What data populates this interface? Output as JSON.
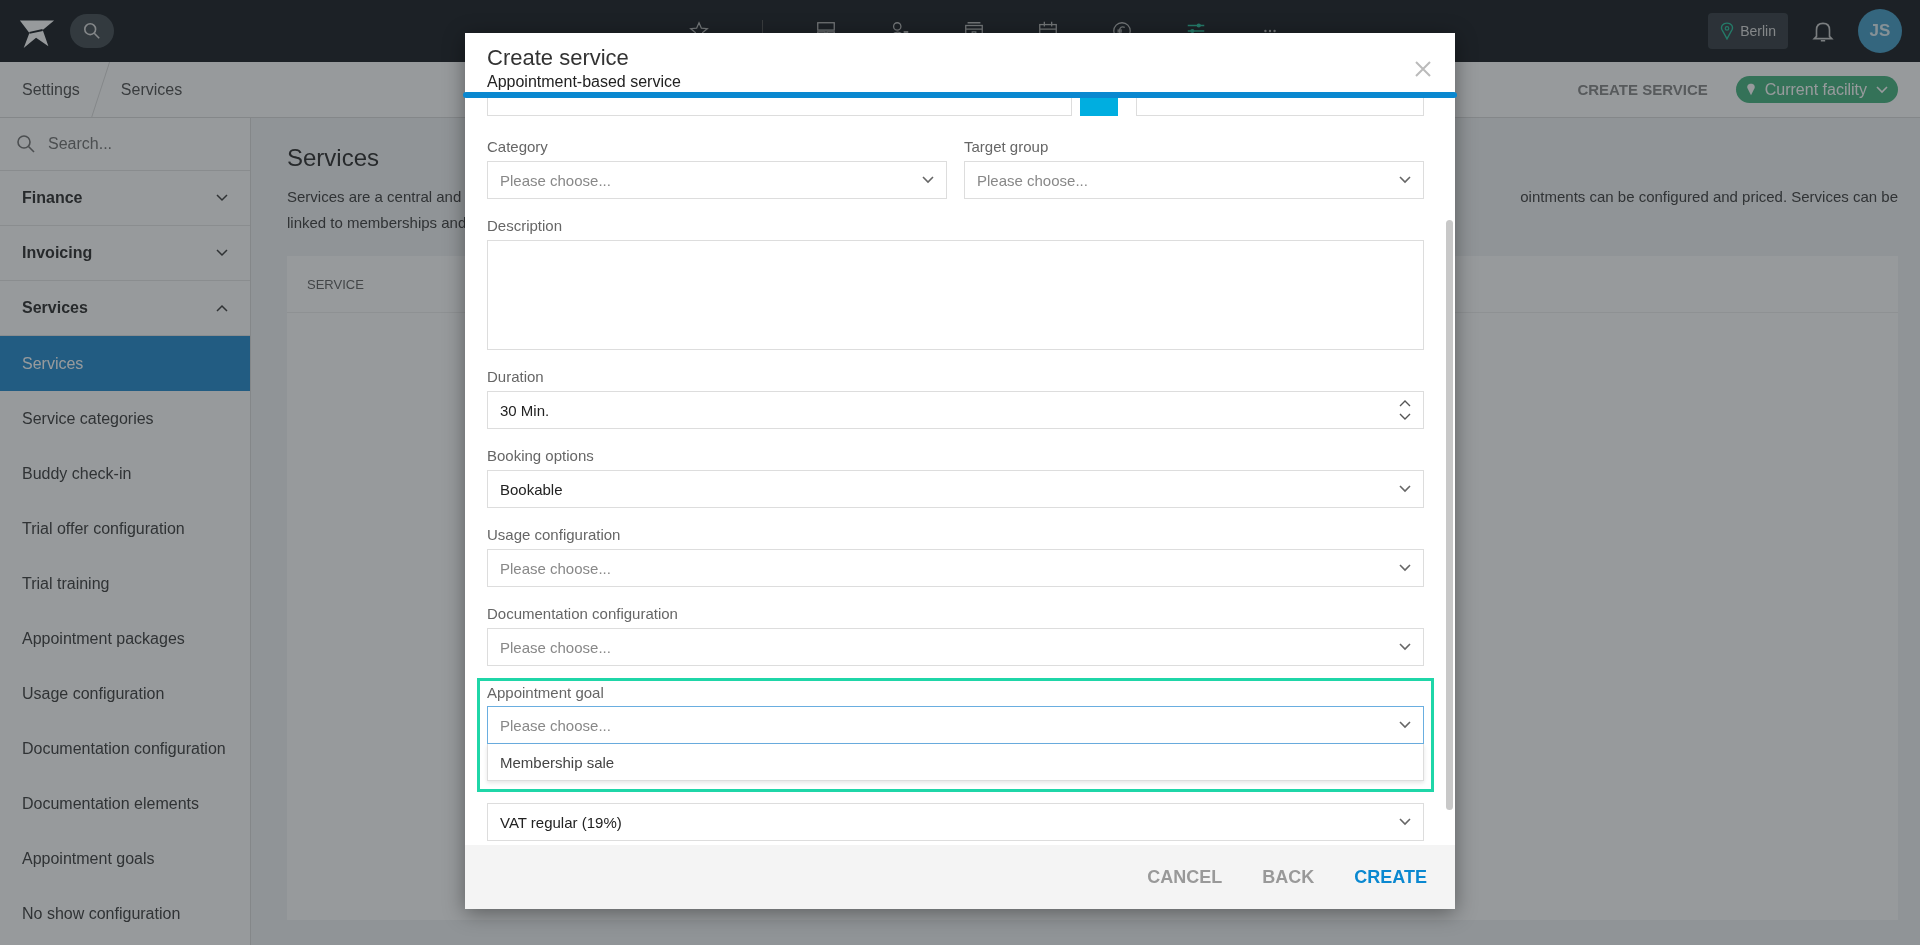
{
  "topbar": {
    "nav_icons": [
      {
        "kind": "star",
        "selected": false
      },
      {
        "kind": "layout",
        "selected": false
      },
      {
        "kind": "person-card",
        "selected": false
      },
      {
        "kind": "calendar-day",
        "selected": false
      },
      {
        "kind": "calendar",
        "selected": false
      },
      {
        "kind": "euro",
        "selected": false
      },
      {
        "kind": "sliders",
        "selected": true
      },
      {
        "kind": "more",
        "selected": false
      }
    ],
    "location": "Berlin",
    "avatar": "JS"
  },
  "breadcrumb": [
    "Settings",
    "Services"
  ],
  "header_actions": {
    "create_button": "CREATE SERVICE",
    "facility": "Current facility"
  },
  "sidebar": {
    "search": {
      "placeholder": "Search..."
    },
    "items": [
      {
        "label": "Finance",
        "expanded": false
      },
      {
        "label": "Invoicing",
        "expanded": false
      },
      {
        "label": "Services",
        "expanded": true,
        "children": [
          {
            "label": "Services",
            "selected": true
          },
          {
            "label": "Service categories",
            "selected": false
          },
          {
            "label": "Buddy check-in",
            "selected": false
          },
          {
            "label": "Trial offer configuration",
            "selected": false
          },
          {
            "label": "Trial training",
            "selected": false
          },
          {
            "label": "Appointment packages",
            "selected": false
          },
          {
            "label": "Usage configuration",
            "selected": false
          },
          {
            "label": "Documentation configuration",
            "selected": false
          },
          {
            "label": "Documentation elements",
            "selected": false
          },
          {
            "label": "Appointment goals",
            "selected": false
          },
          {
            "label": "No show configuration",
            "selected": false
          }
        ]
      }
    ]
  },
  "content": {
    "title": "Services",
    "description_left": [
      "Services are a central and",
      "linked to memberships and"
    ],
    "description_right": "ointments can be configured and priced. Services can be",
    "table": {
      "columns": [
        "SERVICE"
      ]
    }
  },
  "modal": {
    "title": "Create service",
    "subtitle": "Appointment-based service",
    "fields": [
      {
        "kind": "cut-row"
      },
      {
        "kind": "select-pair",
        "items": [
          {
            "label": "Category",
            "placeholder": "Please choose..."
          },
          {
            "label": "Target group",
            "placeholder": "Please choose..."
          }
        ]
      },
      {
        "kind": "textarea",
        "label": "Description"
      },
      {
        "kind": "number",
        "label": "Duration",
        "value": "30 Min."
      },
      {
        "kind": "select",
        "label": "Booking options",
        "value": "Bookable"
      },
      {
        "kind": "select",
        "label": "Usage configuration",
        "placeholder": "Please choose..."
      },
      {
        "kind": "select",
        "label": "Documentation configuration",
        "placeholder": "Please choose..."
      },
      {
        "kind": "select",
        "label": "Appointment goal",
        "placeholder": "Please choose...",
        "open": true,
        "highlighted": true,
        "options": [
          "Membership sale"
        ]
      },
      {
        "kind": "select",
        "value": "VAT regular (19%)"
      }
    ],
    "buttons": [
      {
        "label": "CANCEL",
        "primary": false
      },
      {
        "label": "BACK",
        "primary": false
      },
      {
        "label": "CREATE",
        "primary": true
      }
    ]
  }
}
